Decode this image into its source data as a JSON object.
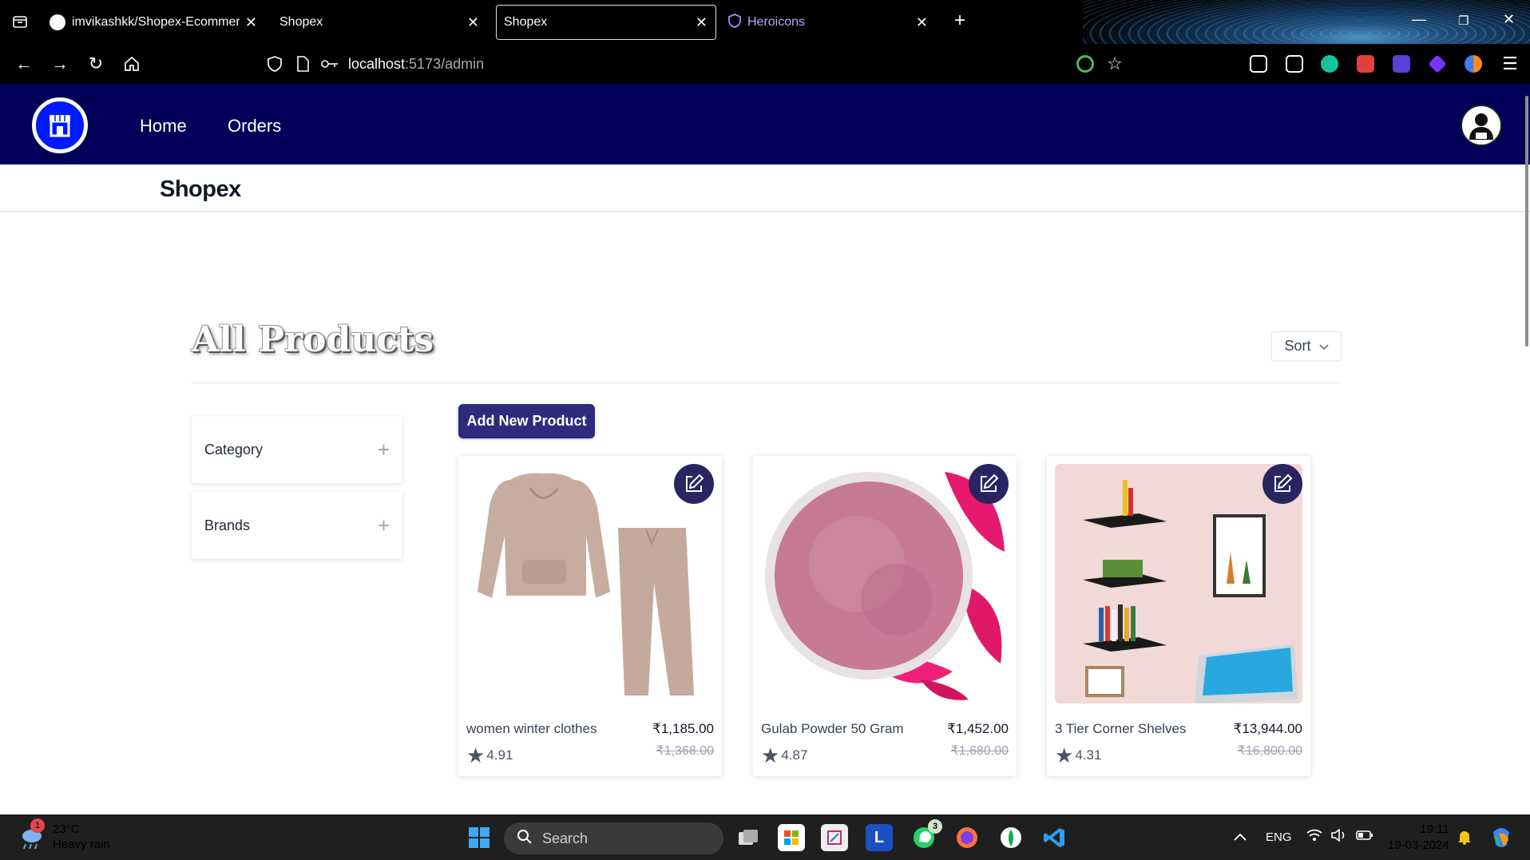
{
  "browser": {
    "tabs": [
      {
        "label": "imvikashkk/Shopex-Ecommerce",
        "active": false
      },
      {
        "label": "Shopex",
        "active": false
      },
      {
        "label": "Shopex",
        "active": true
      },
      {
        "label": "Heroicons",
        "active": false
      }
    ],
    "url_host": "localhost",
    "url_rest": ":5173/admin"
  },
  "navbar": {
    "links": [
      "Home",
      "Orders"
    ]
  },
  "brand": "Shopex",
  "page": {
    "title": "All Products",
    "sort_label": "Sort",
    "add_button": "Add New Product"
  },
  "filters": [
    {
      "label": "Category"
    },
    {
      "label": "Brands"
    }
  ],
  "products": [
    {
      "name": "women winter clothes",
      "price": "₹1,185.00",
      "old_price": "₹1,368.00",
      "rating": "4.91"
    },
    {
      "name": "Gulab Powder 50 Gram",
      "price": "₹1,452.00",
      "old_price": "₹1,680.00",
      "rating": "4.87"
    },
    {
      "name": "3 Tier Corner Shelves",
      "price": "₹13,944.00",
      "old_price": "₹16,800.00",
      "rating": "4.31"
    }
  ],
  "taskbar": {
    "weather_temp": "23°C",
    "weather_desc": "Heavy rain",
    "weather_badge": "1",
    "search_label": "Search",
    "whatsapp_badge": "3",
    "lang": "ENG",
    "time": "19:11",
    "date": "19-03-2024"
  },
  "colors": {
    "navbar_bg": "#000058",
    "logo_bg": "#0019ff",
    "add_button_bg": "#2e2a7e",
    "edit_button_bg": "#2a2560"
  }
}
